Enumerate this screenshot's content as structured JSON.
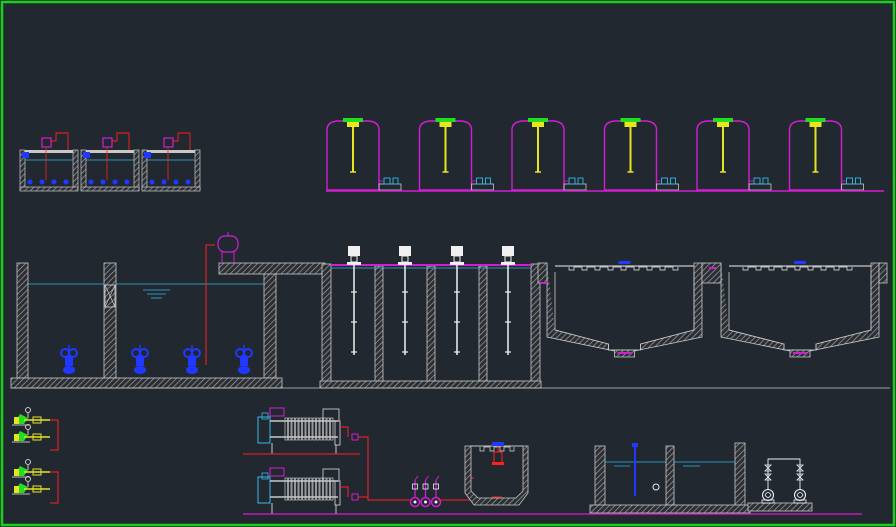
{
  "drawing": {
    "kind": "wastewater treatment process flow drawing (CAD model space)",
    "colors": {
      "background": "#212830",
      "frame": "#19d019",
      "wall": "#c8c8c8",
      "magenta": "#d21ed2",
      "yellow": "#e6e61e",
      "blue": "#2038ff",
      "red": "#ff2020",
      "cyan": "#36b8e6",
      "white": "#f0f0f0",
      "green": "#22dd22",
      "hatch": "#9a9a9a"
    },
    "counts": {
      "dosing_tanks": 6,
      "dosing_pumps": 6,
      "small_tanks": 3,
      "mixers": 4,
      "submersible_pumps": 4,
      "filter_presses": 2,
      "feed_pumps": 3,
      "blowers": 2,
      "air_valves": 4,
      "clarifiers": 2
    }
  }
}
